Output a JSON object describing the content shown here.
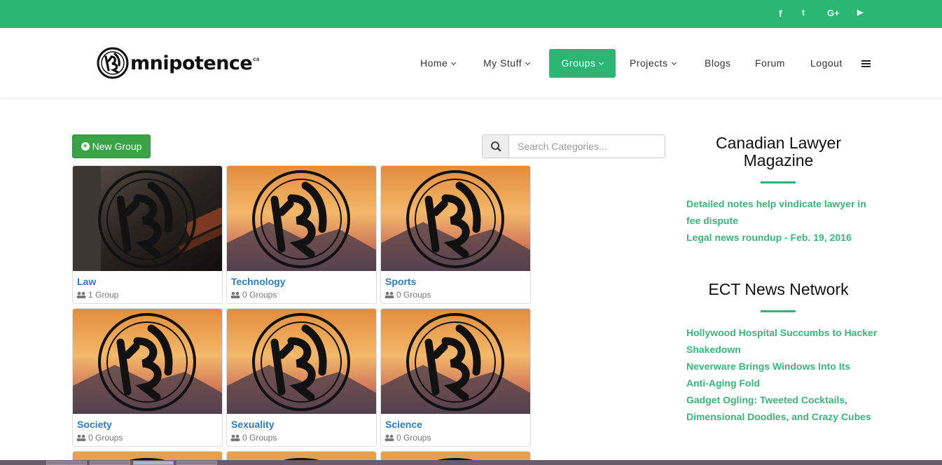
{
  "social": [
    {
      "name": "facebook-icon",
      "glyph": "f"
    },
    {
      "name": "twitter-icon",
      "glyph": "t"
    },
    {
      "name": "google-plus-icon",
      "glyph": "G+"
    },
    {
      "name": "youtube-icon",
      "glyph": "▶"
    }
  ],
  "logo": {
    "word": "mnipotence",
    "sup": "ca"
  },
  "nav": {
    "home": "Home",
    "my_stuff": "My Stuff",
    "groups": "Groups",
    "projects": "Projects",
    "blogs": "Blogs",
    "forum": "Forum",
    "logout": "Logout"
  },
  "toolbar": {
    "new_group": "New Group",
    "search_placeholder": "Search Categories..."
  },
  "categories": [
    {
      "title": "Law",
      "count": "1 Group"
    },
    {
      "title": "Technology",
      "count": "0 Groups"
    },
    {
      "title": "Sports",
      "count": "0 Groups"
    },
    {
      "title": "Society",
      "count": "0 Groups"
    },
    {
      "title": "Sexuality",
      "count": "0 Groups"
    },
    {
      "title": "Science",
      "count": "0 Groups"
    }
  ],
  "sidebar": {
    "widget1": {
      "title_line1": "Canadian Lawyer",
      "title_line2": "Magazine",
      "links": [
        {
          "line1": "Detailed notes help vindicate lawyer in",
          "line2": "fee dispute"
        },
        {
          "line1": "Legal news roundup - Feb. 19, 2016"
        }
      ]
    },
    "widget2": {
      "title": "ECT News Network",
      "links": [
        {
          "line1": "Hollywood Hospital Succumbs to Hacker",
          "line2": "Shakedown"
        },
        {
          "line1": "Neverware Brings Windows Into Its",
          "line2": "Anti-Aging Fold"
        },
        {
          "line1": "Gadget Ogling: Tweeted Cocktails,",
          "line2": "Dimensional Doodles, and Crazy Cubes"
        }
      ]
    }
  },
  "colors": {
    "brand_green": "#2bb673",
    "button_green": "#3aa346",
    "link_blue": "#337ab7",
    "news_green": "#3fb17c"
  }
}
